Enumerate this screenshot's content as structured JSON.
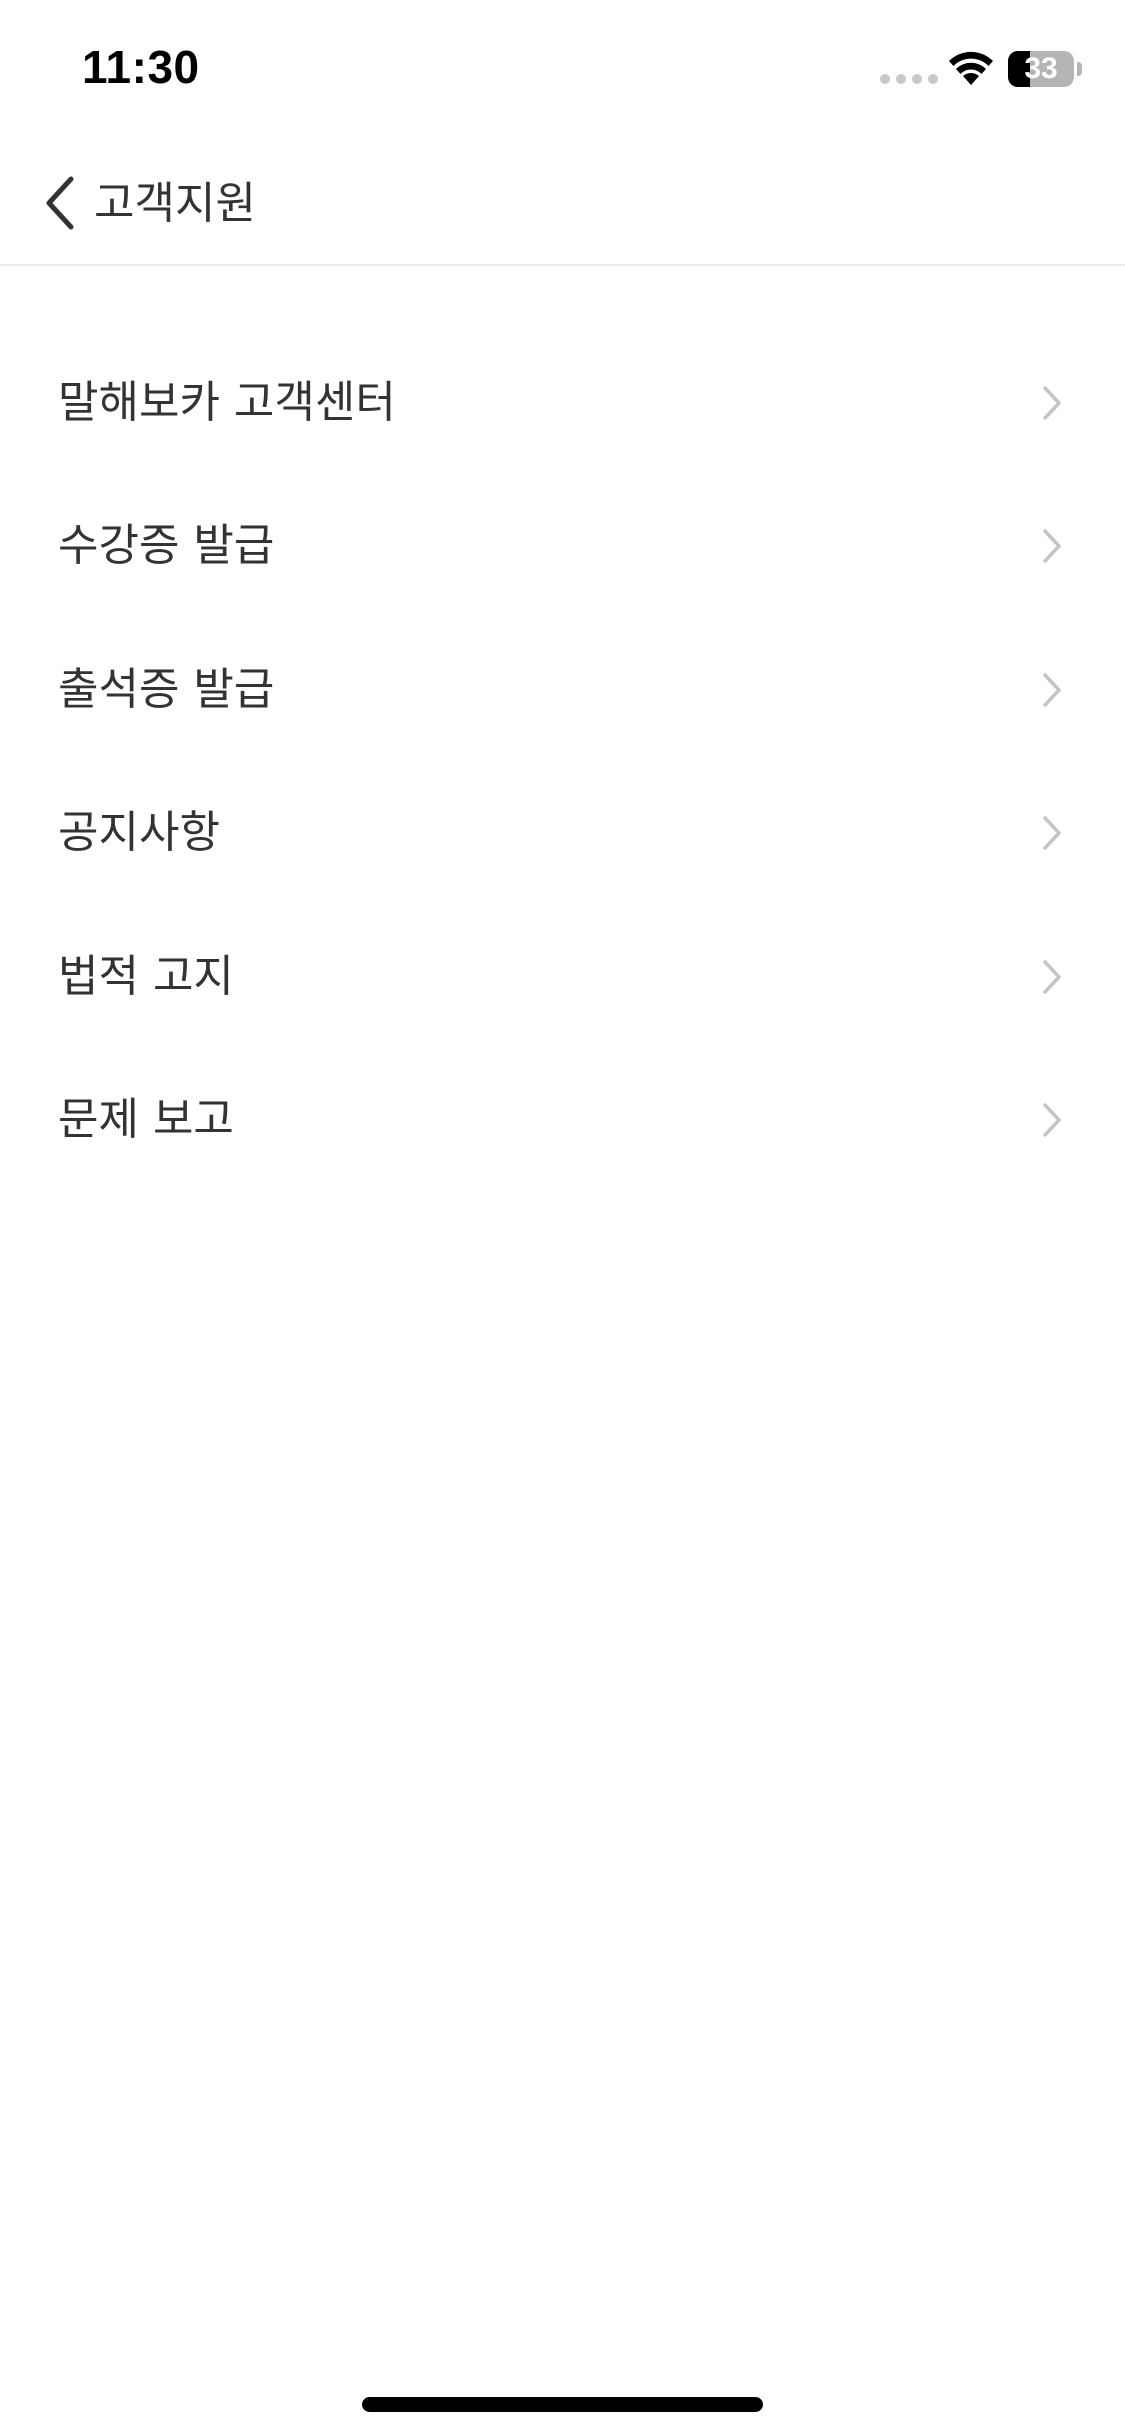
{
  "status_bar": {
    "time": "11:30",
    "battery_level": "33",
    "battery_fraction": 0.33,
    "wifi_icon": "wifi-icon",
    "signal_icon": "cellular-signal-icon"
  },
  "nav": {
    "back_icon": "chevron-left-icon",
    "title": "고객지원"
  },
  "menu": {
    "chevron_icon": "chevron-right-icon",
    "items": [
      {
        "label": "말해보카 고객센터"
      },
      {
        "label": "수강증 발급"
      },
      {
        "label": "출석증 발급"
      },
      {
        "label": "공지사항"
      },
      {
        "label": "법적 고지"
      },
      {
        "label": "문제 보고"
      }
    ]
  },
  "colors": {
    "text": "#333333",
    "chevron": "#c4c4c4",
    "divider": "#ebebeb",
    "background": "#ffffff"
  }
}
